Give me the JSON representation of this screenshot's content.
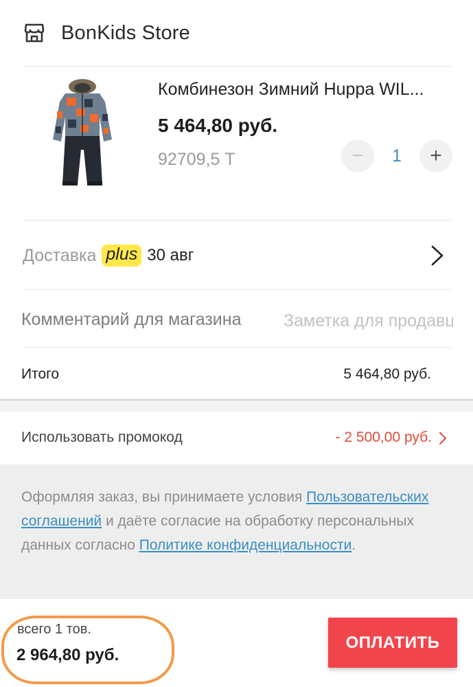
{
  "store": {
    "name": "BonKids Store",
    "icon": "store-icon"
  },
  "product": {
    "title": "Комбинезон Зимний Huppa WIL...",
    "price": "5 464,80 руб.",
    "points": "92709,5 Т",
    "quantity": "1",
    "minus_label": "−",
    "plus_label": "+"
  },
  "delivery": {
    "label": "Доставка",
    "badge": "plus",
    "date": "30 авг"
  },
  "comment": {
    "label": "Комментарий для магазина",
    "placeholder": "Заметка для продавца"
  },
  "total": {
    "label": "Итого",
    "value": "5 464,80 руб."
  },
  "promo": {
    "label": "Использовать промокод",
    "value": "- 2 500,00 руб."
  },
  "terms": {
    "part1": "Оформляя заказ, вы принимаете условия ",
    "link1": "Пользовательских соглашений",
    "part2": " и даёте согласие на обработку персональных данных согласно ",
    "link2": "Политике конфиденциальности",
    "part3": "."
  },
  "footer": {
    "count": "всего 1 тов.",
    "sum": "2 964,80 руб.",
    "pay_label": "ОПЛАТИТЬ"
  },
  "colors": {
    "accent": "#f2444b",
    "link": "#3a8fc0",
    "discount": "#e04a3a",
    "plus_badge": "#ffe84b",
    "highlight": "#f39a4a"
  }
}
